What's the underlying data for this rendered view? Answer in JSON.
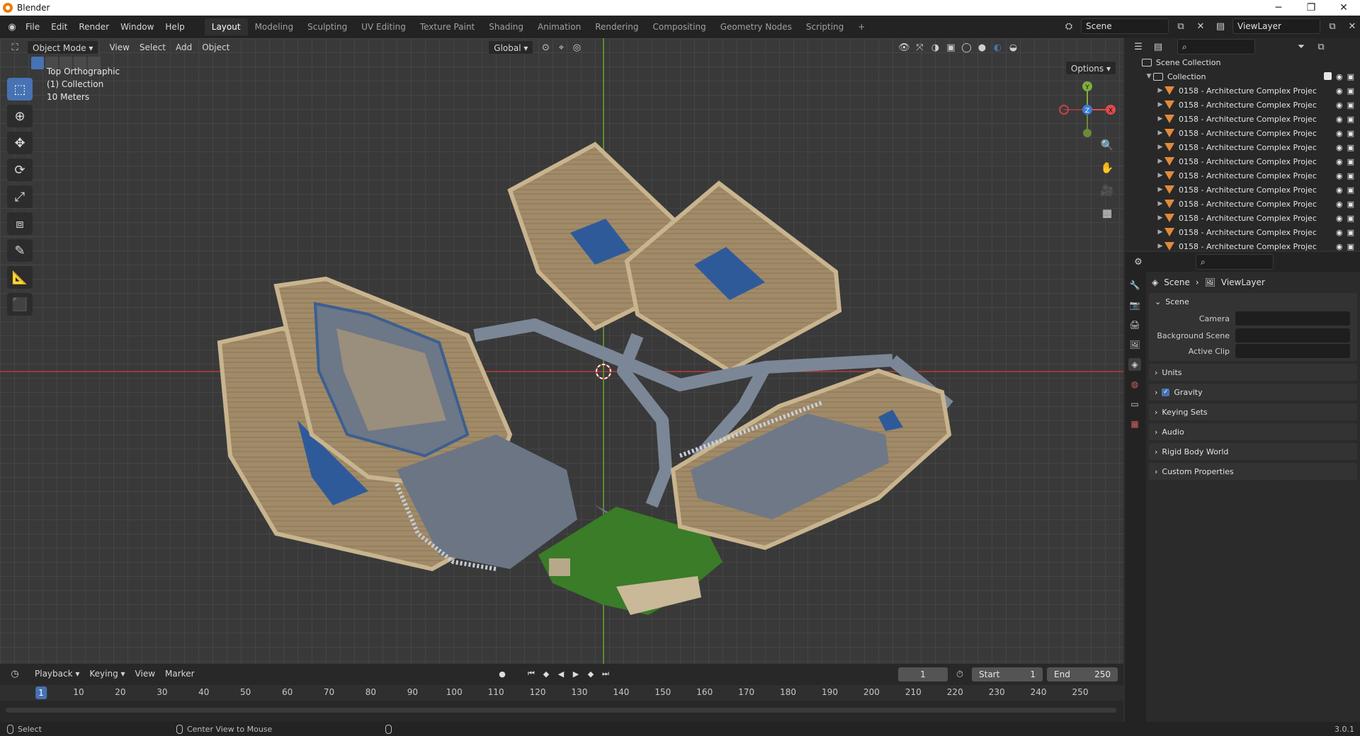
{
  "window": {
    "title": "Blender",
    "controls": [
      "─",
      "❐",
      "✕"
    ]
  },
  "menu": [
    "File",
    "Edit",
    "Render",
    "Window",
    "Help"
  ],
  "workspaces": [
    {
      "label": "Layout",
      "active": true
    },
    {
      "label": "Modeling"
    },
    {
      "label": "Sculpting"
    },
    {
      "label": "UV Editing"
    },
    {
      "label": "Texture Paint"
    },
    {
      "label": "Shading"
    },
    {
      "label": "Animation"
    },
    {
      "label": "Rendering"
    },
    {
      "label": "Compositing"
    },
    {
      "label": "Geometry Nodes"
    },
    {
      "label": "Scripting"
    }
  ],
  "add_workspace": "+",
  "scene_name": "Scene",
  "view_layer_name": "ViewLayer",
  "viewport": {
    "mode": "Object Mode",
    "menus": [
      "View",
      "Select",
      "Add",
      "Object"
    ],
    "transform_orientation": "Global",
    "options_label": "Options",
    "overlay_lines": [
      "Top Orthographic",
      "(1) Collection",
      "10 Meters"
    ],
    "gizmo_axes": {
      "x": "X",
      "y": "Y",
      "z": "Z"
    }
  },
  "colors": {
    "accent": "#4772b3",
    "mesh_icon": "#e08a3a",
    "axis_x": "#9b3a3a",
    "axis_y": "#5c8a2c"
  },
  "timeline": {
    "menus": [
      "Playback",
      "Keying",
      "View",
      "Marker"
    ],
    "current_frame": "1",
    "start_label": "Start",
    "start_value": "1",
    "end_label": "End",
    "end_value": "250",
    "ruler": [
      "1",
      "10",
      "20",
      "30",
      "40",
      "50",
      "60",
      "70",
      "80",
      "90",
      "100",
      "110",
      "120",
      "130",
      "140",
      "150",
      "160",
      "170",
      "180",
      "190",
      "200",
      "210",
      "220",
      "230",
      "240",
      "250"
    ]
  },
  "statusbar": {
    "select": "Select",
    "center_view": "Center View to Mouse",
    "version": "3.0.1"
  },
  "outliner": {
    "scene_collection": "Scene Collection",
    "collection": "Collection",
    "items": [
      "0158 - Architecture Complex Projec",
      "0158 - Architecture Complex Projec",
      "0158 - Architecture Complex Projec",
      "0158 - Architecture Complex Projec",
      "0158 - Architecture Complex Projec",
      "0158 - Architecture Complex Projec",
      "0158 - Architecture Complex Projec",
      "0158 - Architecture Complex Projec",
      "0158 - Architecture Complex Projec",
      "0158 - Architecture Complex Projec",
      "0158 - Architecture Complex Projec",
      "0158 - Architecture Complex Projec"
    ]
  },
  "properties": {
    "breadcrumb_scene": "Scene",
    "breadcrumb_layer": "ViewLayer",
    "scene_panel": "Scene",
    "camera_label": "Camera",
    "background_label": "Background Scene",
    "clip_label": "Active Clip",
    "panels": [
      "Units",
      "Gravity",
      "Keying Sets",
      "Audio",
      "Rigid Body World",
      "Custom Properties"
    ]
  }
}
